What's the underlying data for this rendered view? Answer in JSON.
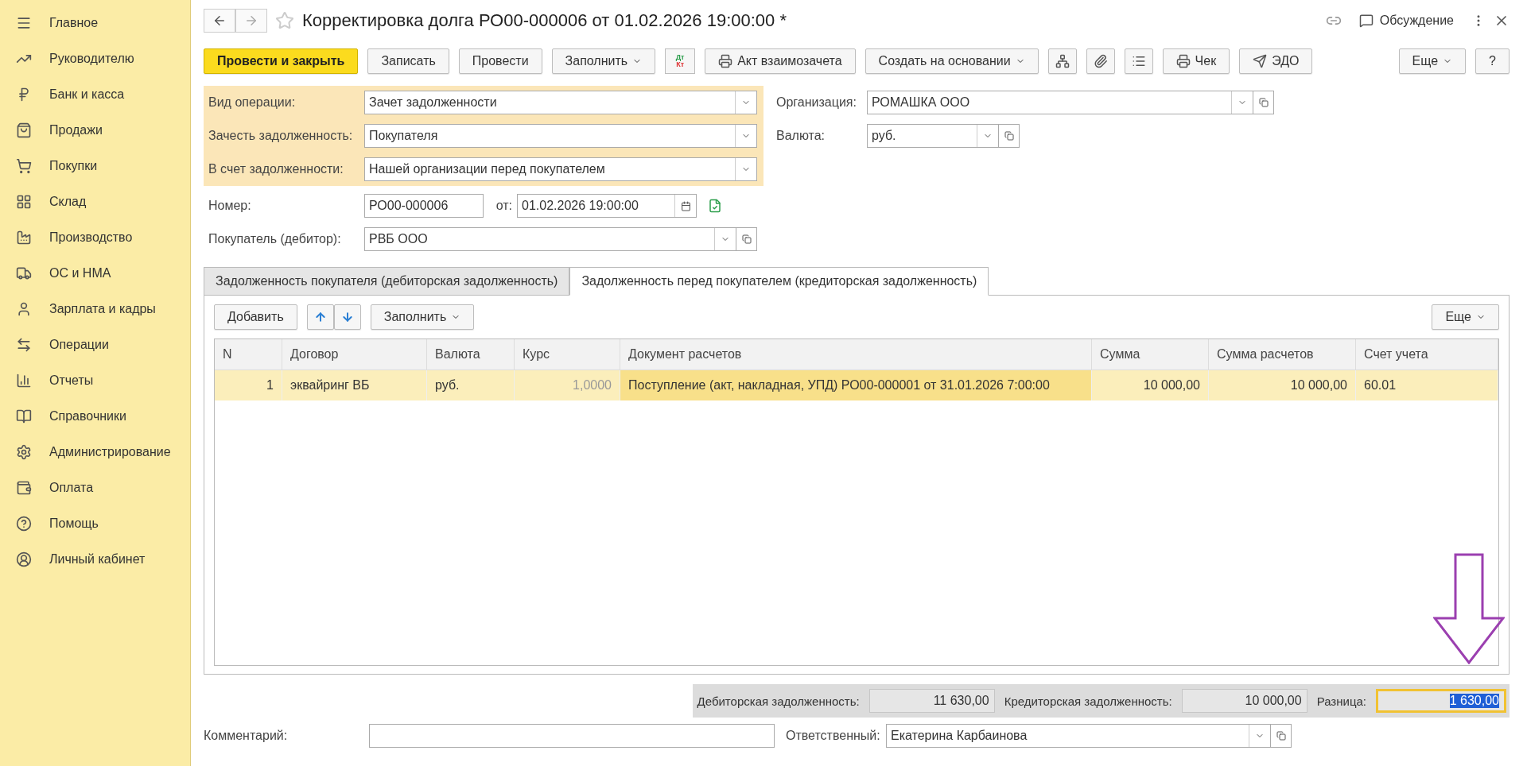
{
  "sidebar": {
    "items": [
      {
        "label": "Главное"
      },
      {
        "label": "Руководителю"
      },
      {
        "label": "Банк и касса"
      },
      {
        "label": "Продажи"
      },
      {
        "label": "Покупки"
      },
      {
        "label": "Склад"
      },
      {
        "label": "Производство"
      },
      {
        "label": "ОС и НМА"
      },
      {
        "label": "Зарплата и кадры"
      },
      {
        "label": "Операции"
      },
      {
        "label": "Отчеты"
      },
      {
        "label": "Справочники"
      },
      {
        "label": "Администрирование"
      },
      {
        "label": "Оплата"
      },
      {
        "label": "Помощь"
      },
      {
        "label": "Личный кабинет"
      }
    ]
  },
  "window": {
    "title": "Корректировка долга РО00-000006 от 01.02.2026 19:00:00 *",
    "starred": false,
    "discussion": "Обсуждение"
  },
  "toolbar": [
    {
      "kind": "primary",
      "label": "Провести и закрыть"
    },
    {
      "kind": "plain",
      "label": "Записать"
    },
    {
      "kind": "plain",
      "label": "Провести"
    },
    {
      "kind": "dropdown",
      "label": "Заполнить"
    },
    {
      "kind": "dtkt",
      "top": "Дт",
      "bottom": "Кт"
    },
    {
      "kind": "print",
      "label": "Акт взаимозачета"
    },
    {
      "kind": "dropdown",
      "label": "Создать на основании"
    },
    {
      "kind": "structure"
    },
    {
      "kind": "paperclip"
    },
    {
      "kind": "list"
    },
    {
      "kind": "print",
      "label": "Чек"
    },
    {
      "kind": "edo",
      "label": "ЭДО"
    }
  ],
  "toolbar_right": [
    {
      "kind": "dropdown",
      "label": "Еще"
    },
    {
      "kind": "plain",
      "label": "?"
    }
  ],
  "operation_fields": [
    {
      "label": "Вид операции:",
      "value": "Зачет задолженности"
    },
    {
      "label": "Зачесть задолженность:",
      "value": "Покупателя"
    },
    {
      "label": "В счет задолженности:",
      "value": "Нашей организации перед покупателем"
    }
  ],
  "organization": {
    "label": "Организация:",
    "value": "РОМАШКА ООО"
  },
  "currency": {
    "label": "Валюта:",
    "value": "руб."
  },
  "number": {
    "label": "Номер:",
    "value": "РО00-000006",
    "date_label": "от:",
    "date": "01.02.2026 19:00:00"
  },
  "buyer": {
    "label": "Покупатель (дебитор):",
    "value": "РВБ ООО"
  },
  "tabs": [
    {
      "label": "Задолженность покупателя (дебиторская задолженность)",
      "selected": false
    },
    {
      "label": "Задолженность перед покупателем (кредиторская задолженность)",
      "selected": true
    }
  ],
  "table_toolbar": {
    "add": "Добавить",
    "fill": "Заполнить",
    "more": "Еще"
  },
  "table": {
    "columns": [
      "N",
      "Договор",
      "Валюта",
      "Курс",
      "Документ расчетов",
      "Сумма",
      "Сумма расчетов",
      "Счет учета"
    ],
    "rows": [
      {
        "selected": true,
        "cells": [
          {
            "text": "1",
            "current": false
          },
          {
            "text": "эквайринг ВБ",
            "current": false
          },
          {
            "text": "руб.",
            "current": false
          },
          {
            "text": "1,0000",
            "current": false
          },
          {
            "text": "Поступление (акт, накладная, УПД) РО00-000001 от 31.01.2026 7:00:00",
            "current": true
          },
          {
            "text": "10 000,00",
            "current": false
          },
          {
            "text": "10 000,00",
            "current": false
          },
          {
            "text": "60.01",
            "current": false
          }
        ]
      }
    ]
  },
  "totals": [
    {
      "label": "Дебиторская задолженность:",
      "value": "11 630,00",
      "highlighted": false
    },
    {
      "label": "Кредиторская задолженность:",
      "value": "10 000,00",
      "highlighted": false
    },
    {
      "label": "Разница:",
      "value": "1 630,00",
      "highlighted": true
    }
  ],
  "comment": {
    "label": "Комментарий:"
  },
  "responsible": {
    "label": "Ответственный:",
    "value": "Екатерина Карбаинова"
  }
}
